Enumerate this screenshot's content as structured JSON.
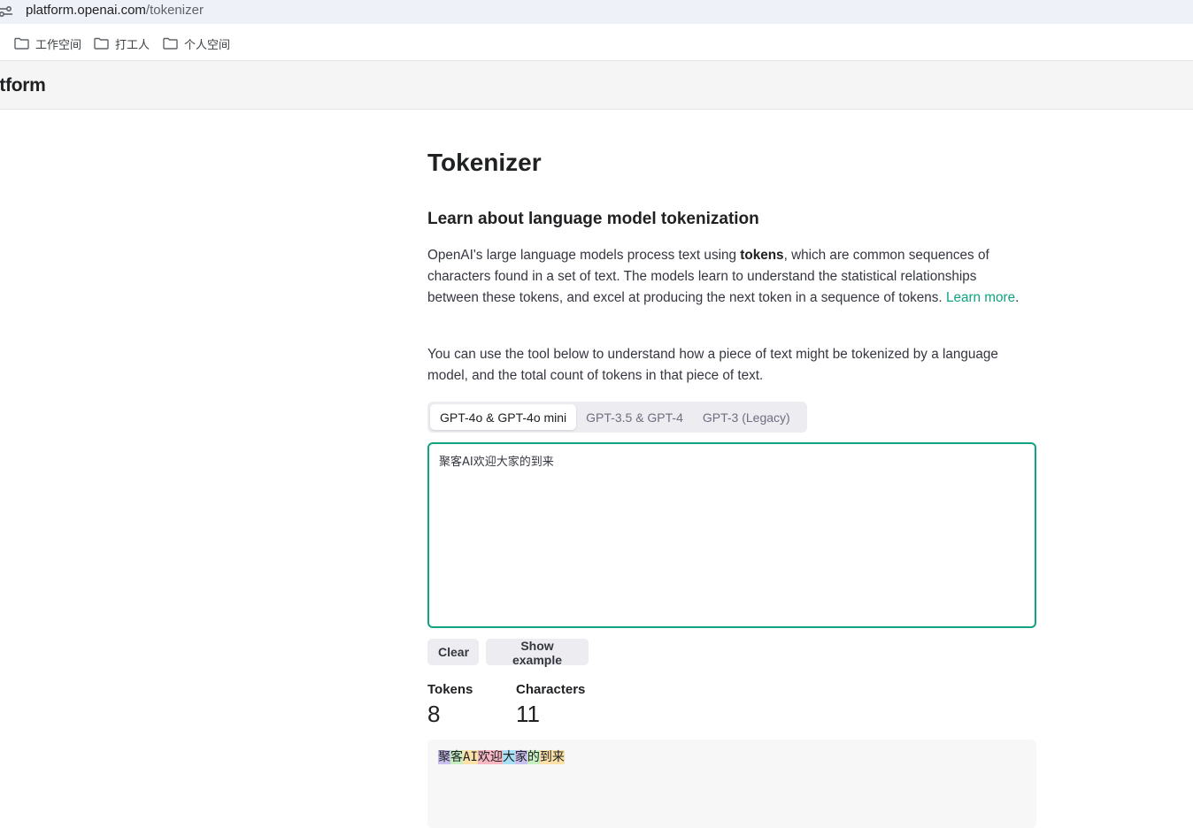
{
  "browser": {
    "url_host": "platform.openai.com",
    "url_path": "/tokenizer"
  },
  "bookmarks": [
    {
      "label": "工作空间"
    },
    {
      "label": "打工人"
    },
    {
      "label": "个人空间"
    }
  ],
  "header": {
    "brand": "atform"
  },
  "page": {
    "title": "Tokenizer",
    "section_title": "Learn about language model tokenization",
    "para1_a": "OpenAI's large language models process text using ",
    "para1_bold": "tokens",
    "para1_b": ", which are common sequences of characters found in a set of text. The models learn to understand the statistical relationships between these tokens, and excel at producing the next token in a sequence of tokens. ",
    "learn_more": "Learn more",
    "para1_end": ".",
    "para2": "You can use the tool below to understand how a piece of text might be tokenized by a language model, and the total count of tokens in that piece of text."
  },
  "tabs": [
    {
      "label": "GPT-4o & GPT-4o mini",
      "active": true
    },
    {
      "label": "GPT-3.5 & GPT-4",
      "active": false
    },
    {
      "label": "GPT-3 (Legacy)",
      "active": false
    }
  ],
  "input": {
    "value": "聚客AI欢迎大家的到来"
  },
  "buttons": {
    "clear": "Clear",
    "show_example": "Show example"
  },
  "stats": {
    "tokens_label": "Tokens",
    "tokens_value": "8",
    "chars_label": "Characters",
    "chars_value": "11"
  },
  "tokens": [
    {
      "text": "聚",
      "color": "#c9c0f0"
    },
    {
      "text": "客",
      "color": "#c6efc2"
    },
    {
      "text": "AI",
      "color": "#fce2a8"
    },
    {
      "text": "欢迎",
      "color": "#f7b8c4"
    },
    {
      "text": "大",
      "color": "#a7dff4"
    },
    {
      "text": "家",
      "color": "#c9c0f0"
    },
    {
      "text": "的",
      "color": "#c6efc2"
    },
    {
      "text": "到来",
      "color": "#fce2a8"
    }
  ]
}
